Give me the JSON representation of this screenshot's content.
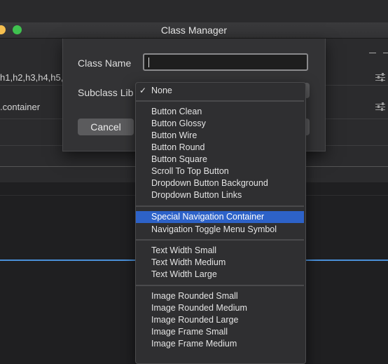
{
  "window": {
    "title": "Class Manager"
  },
  "background_rows": [
    {
      "text": "h1,h2,h3,h4,h5,"
    },
    {
      "text": ".container"
    }
  ],
  "dialog": {
    "class_name_label": "Class Name",
    "class_name_value": "",
    "subclass_label": "Subclass Lib",
    "cancel_label": "Cancel"
  },
  "menu": {
    "selected": "None",
    "groups": [
      [
        "None"
      ],
      [
        "Button Clean",
        "Button Glossy",
        "Button Wire",
        "Button Round",
        "Button Square",
        "Scroll To Top Button",
        "Dropdown Button Background",
        "Dropdown Button Links"
      ],
      [
        "Special Navigation Container",
        "Navigation Toggle Menu Symbol"
      ],
      [
        "Text Width Small",
        "Text Width Medium",
        "Text Width Large"
      ],
      [
        "Image Rounded Small",
        "Image Rounded Medium",
        "Image Rounded Large",
        "Image Frame Small",
        "Image Frame Medium"
      ]
    ],
    "highlighted": "Special Navigation Container"
  },
  "colors": {
    "highlight": "#2d62c8",
    "accent_line": "#4a90d9",
    "traffic_yellow": "#f5bf4f",
    "traffic_green": "#3fc24f"
  }
}
